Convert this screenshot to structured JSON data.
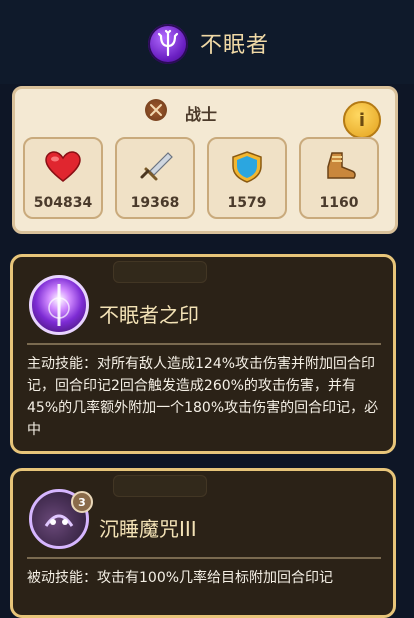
{
  "header": {
    "title": "不眠者",
    "logo_icon": "trident-emblem-icon"
  },
  "class": {
    "label": "战士",
    "icon": "crossed-swords-icon",
    "info_label": "i"
  },
  "stats": [
    {
      "icon": "heart-icon",
      "value": "504834"
    },
    {
      "icon": "sword-icon",
      "value": "19368"
    },
    {
      "icon": "shield-icon",
      "value": "1579"
    },
    {
      "icon": "boot-icon",
      "value": "1160"
    }
  ],
  "skills": [
    {
      "name": "不眠者之印",
      "icon": "purple-sigil-icon",
      "description": "主动技能：对所有敌人造成124%攻击伤害并附加回合印记，回合印记2回合触发造成260%的攻击伤害，并有45%的几率额外附加一个180%攻击伤害的回合印记，必中"
    },
    {
      "name": "沉睡魔咒III",
      "icon": "sleep-curse-icon",
      "level": "3",
      "description": "被动技能：攻击有100%几率给目标附加回合印记"
    }
  ],
  "colors": {
    "background": "#0e1626",
    "card_border": "#e7c57a",
    "stats_bg": "#f4e9d3"
  }
}
